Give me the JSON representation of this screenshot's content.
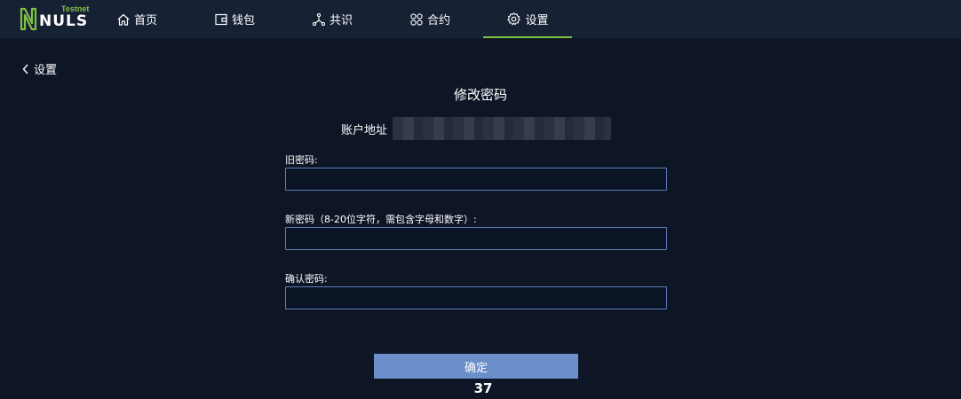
{
  "brand": {
    "name": "NULS",
    "badge": "Testnet",
    "accent_color": "#7fc242"
  },
  "nav": {
    "items": [
      {
        "label": "首页",
        "icon": "home-icon"
      },
      {
        "label": "钱包",
        "icon": "wallet-icon"
      },
      {
        "label": "共识",
        "icon": "consensus-icon"
      },
      {
        "label": "合约",
        "icon": "contract-icon"
      },
      {
        "label": "设置",
        "icon": "gear-icon",
        "active": true
      }
    ]
  },
  "back": {
    "label": "设置"
  },
  "page": {
    "title": "修改密码",
    "address_label": "账户地址",
    "page_number": "37"
  },
  "form": {
    "old_password_label": "旧密码:",
    "new_password_label": "新密码（8-20位字符，需包含字母和数字）:",
    "confirm_password_label": "确认密码:",
    "old_password_value": "",
    "new_password_value": "",
    "confirm_password_value": "",
    "submit_label": "确定"
  },
  "colors": {
    "background": "#0e1626",
    "topbar": "#172134",
    "input_border": "#5a7fb8",
    "button": "#6b8fc9"
  }
}
